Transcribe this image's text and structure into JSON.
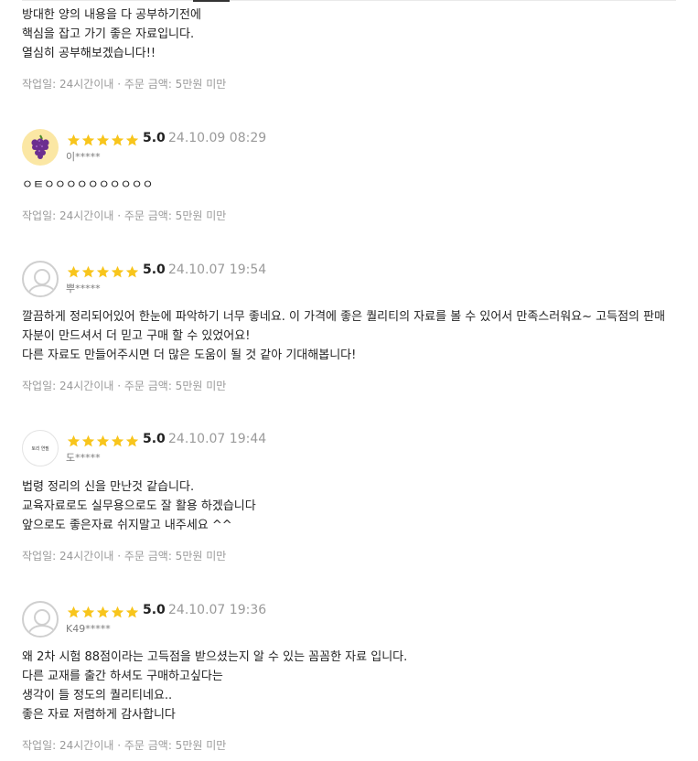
{
  "colors": {
    "star": "#f8c51c",
    "meta_text": "#9a9a9a",
    "body_text": "#222222",
    "avatar_grape_bg": "#fbe7a4"
  },
  "reviews": [
    {
      "lines": [
        "방대한 양의 내용을 다 공부하기전에",
        "핵심을 잡고 가기 좋은 자료입니다.",
        "열심히 공부해보겠습니다!!"
      ],
      "meta": "작업일: 24시간이내 · 주문 금액: 5만원 미만"
    },
    {
      "avatar": "grape-icon",
      "rating": 5,
      "score": "5.0",
      "date": "24.10.09 08:29",
      "user": "이*****",
      "lines": [
        "ㅇㅌㅇㅇㅇㅇㅇㅇㅇㅇㅇㅇ"
      ],
      "meta": "작업일: 24시간이내 · 주문 금액: 5만원 미만"
    },
    {
      "avatar": "default-user-icon",
      "rating": 5,
      "score": "5.0",
      "date": "24.10.07 19:54",
      "user": "뿌*****",
      "lines": [
        "깔끔하게 정리되어있어 한눈에 파악하기 너무 좋네요. 이 가격에 좋은 퀄리티의 자료를 볼 수 있어서 만족스러워요~ 고득점의 판매",
        "자분이 만드셔서 더 믿고 구매 할 수 있었어요!",
        "다른 자료도 만들어주시면 더 많은 도움이 될 것 같아 기대해봅니다!"
      ],
      "meta": "작업일: 24시간이내 · 주문 금액: 5만원 미만"
    },
    {
      "avatar": "logo-icon",
      "avatar_text": "토리 연필",
      "rating": 5,
      "score": "5.0",
      "date": "24.10.07 19:44",
      "user": "도*****",
      "lines": [
        "법령 정리의 신을 만난것 같습니다.",
        "교육자료로도 실무용으로도 잘 활용 하겠습니다",
        "앞으로도 좋은자료 쉬지말고 내주세요 ^^"
      ],
      "meta": "작업일: 24시간이내 · 주문 금액: 5만원 미만"
    },
    {
      "avatar": "default-user-icon",
      "rating": 5,
      "score": "5.0",
      "date": "24.10.07 19:36",
      "user": "K49*****",
      "lines": [
        "왜 2차 시험 88점이라는 고득점을 받으셨는지 알 수 있는 꼼꼼한 자료 입니다.",
        "다른 교재를 출간 하셔도 구매하고싶다는",
        "생각이 들 정도의 퀄리티네요..",
        "좋은 자료 저렴하게 감사합니다"
      ],
      "meta": "작업일: 24시간이내 · 주문 금액: 5만원 미만"
    }
  ]
}
